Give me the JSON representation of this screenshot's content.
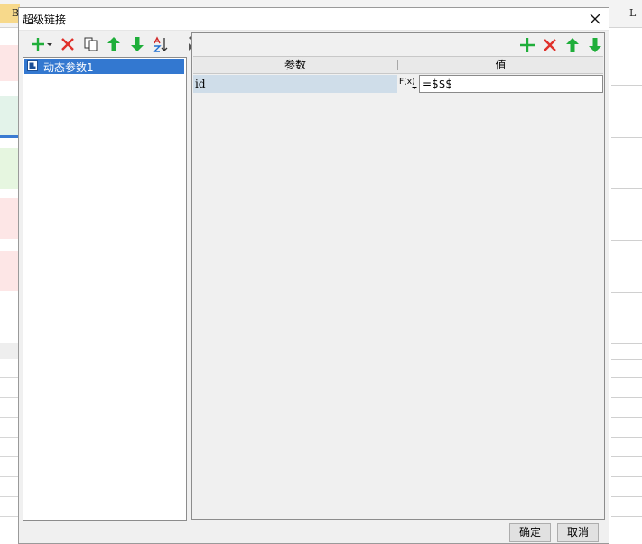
{
  "background": {
    "column_headers": [
      "B",
      "L"
    ]
  },
  "dialog": {
    "title": "超级链接",
    "close_icon": "close-icon"
  },
  "left_toolbar": {
    "icons": [
      "add-dropdown-icon",
      "delete-icon",
      "copy-icon",
      "move-up-icon",
      "move-down-icon",
      "sort-icon"
    ]
  },
  "tree": {
    "items": [
      {
        "label": "动态参数1",
        "selected": true,
        "icon": "hyperlink-item-icon"
      }
    ]
  },
  "right_toolbar": {
    "icons": [
      "add-icon",
      "delete-icon",
      "move-up-icon",
      "move-down-icon"
    ]
  },
  "grid": {
    "columns": [
      "参数",
      "值"
    ],
    "rows": [
      {
        "param": "id",
        "fx_label": "F(x)",
        "value": "=$$$"
      }
    ]
  },
  "footer": {
    "ok_label": "确定",
    "cancel_label": "取消"
  },
  "colors": {
    "selection": "#3378d0",
    "row_highlight": "#cfdde9",
    "add_green": "#1fae3a",
    "delete_red": "#e0302a"
  }
}
